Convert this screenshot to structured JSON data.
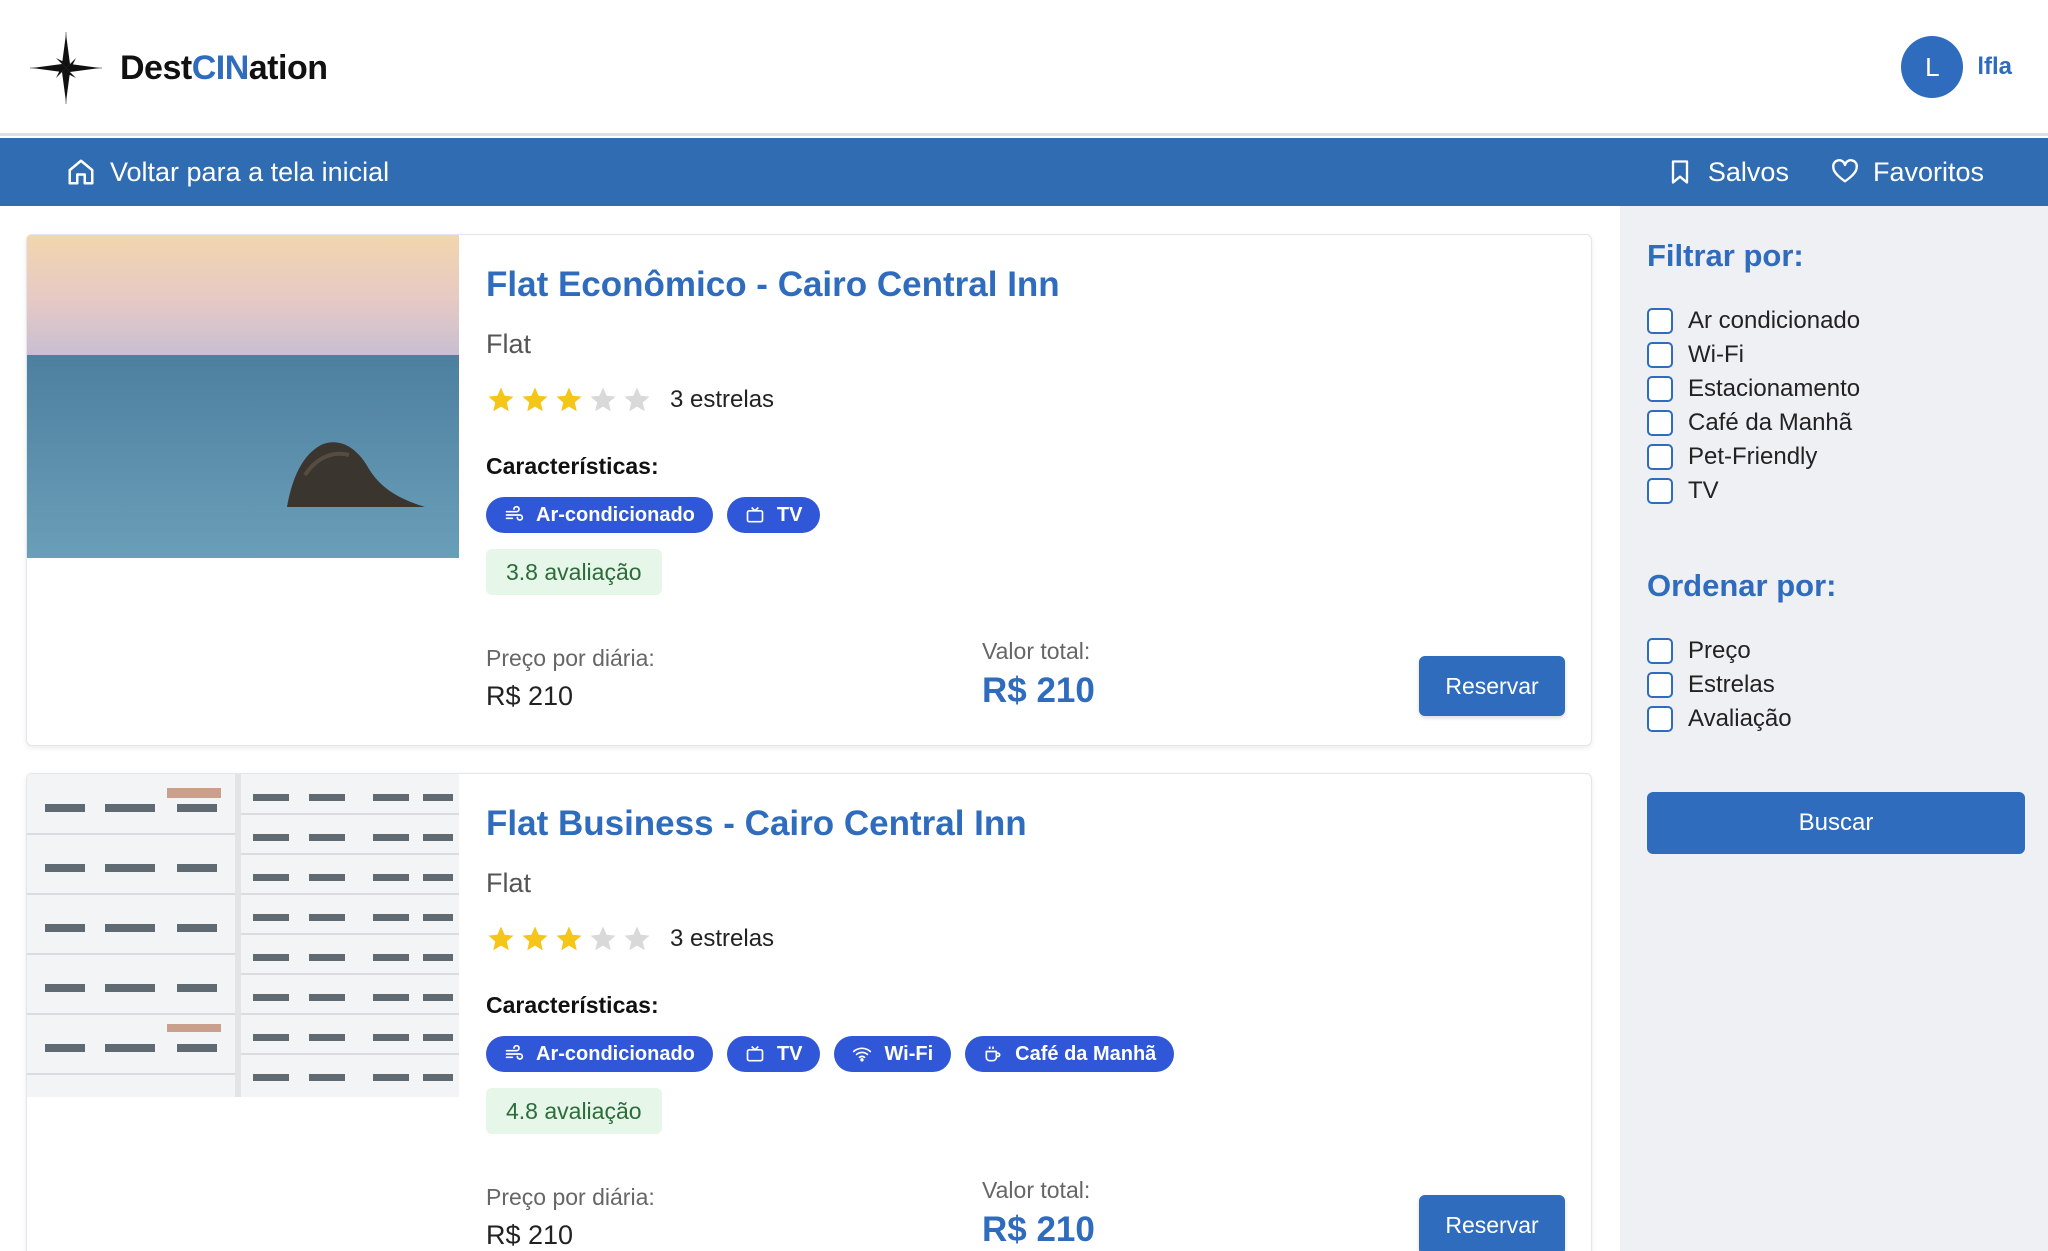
{
  "header": {
    "logo_text_a": "Dest",
    "logo_text_b": "CIN",
    "logo_text_c": "ation",
    "user_initial": "L",
    "user_name": "lfla"
  },
  "nav": {
    "home_label": "Voltar para a tela inicial",
    "saved_label": "Salvos",
    "favorites_label": "Favoritos"
  },
  "listings": [
    {
      "title": "Flat Econômico - Cairo Central Inn",
      "type": "Flat",
      "stars": 3,
      "stars_label": "3 estrelas",
      "features_title": "Características:",
      "features": [
        "Ar-condicionado",
        "TV"
      ],
      "rating": "3.8 avaliação",
      "price_label": "Preço por diária:",
      "price": "R$ 210",
      "total_label": "Valor total:",
      "total": "R$ 210",
      "button": "Reservar"
    },
    {
      "title": "Flat Business - Cairo Central Inn",
      "type": "Flat",
      "stars": 3,
      "stars_label": "3 estrelas",
      "features_title": "Características:",
      "features": [
        "Ar-condicionado",
        "TV",
        "Wi-Fi",
        "Café da Manhã"
      ],
      "rating": "4.8 avaliação",
      "price_label": "Preço por diária:",
      "price": "R$ 210",
      "total_label": "Valor total:",
      "total": "R$ 210",
      "button": "Reservar"
    }
  ],
  "sidebar": {
    "filter_title": "Filtrar por:",
    "filters": [
      "Ar condicionado",
      "Wi-Fi",
      "Estacionamento",
      "Café da Manhã",
      "Pet-Friendly",
      "TV"
    ],
    "sort_title": "Ordenar por:",
    "sorts": [
      "Preço",
      "Estrelas",
      "Avaliação"
    ],
    "search_button": "Buscar"
  },
  "colors": {
    "brand": "#2f6cbd",
    "chip": "#2f57d8",
    "star_on": "#f5c518",
    "star_off": "#d9d9d9"
  }
}
